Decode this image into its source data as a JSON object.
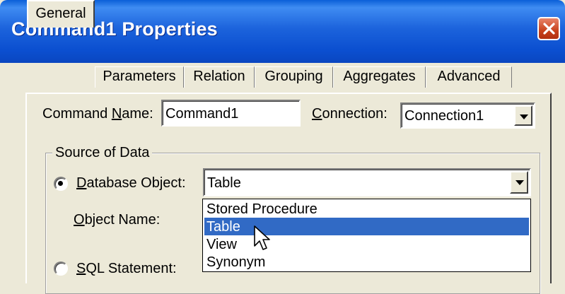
{
  "window": {
    "title": "Command1 Properties",
    "close_icon": "close-icon"
  },
  "tabs": [
    {
      "label": "General",
      "active": true
    },
    {
      "label": "Parameters",
      "active": false
    },
    {
      "label": "Relation",
      "active": false
    },
    {
      "label": "Grouping",
      "active": false
    },
    {
      "label": "Aggregates",
      "active": false
    },
    {
      "label": "Advanced",
      "active": false
    }
  ],
  "general": {
    "command_name_label_pre": "Command ",
    "command_name_label_u": "N",
    "command_name_label_post": "ame:",
    "command_name_value": "Command1",
    "connection_label_u": "C",
    "connection_label_post": "onnection:",
    "connection_value": "Connection1"
  },
  "source_of_data": {
    "group_title": "Source of Data",
    "database_object": {
      "label_u": "D",
      "label_post": "atabase Object:",
      "selected": true,
      "value": "Table",
      "options": [
        "Stored Procedure",
        "Table",
        "View",
        "Synonym"
      ],
      "highlighted_option": "Table"
    },
    "object_name": {
      "label_u": "O",
      "label_post": "bject Name:"
    },
    "sql_statement": {
      "label_u": "S",
      "label_post": "QL Statement:",
      "selected": false
    }
  },
  "colors": {
    "title_bar": "#0a4fd0",
    "selection": "#316ac5",
    "close_button": "#c8421c",
    "dialog_face": "#ece9d8"
  }
}
